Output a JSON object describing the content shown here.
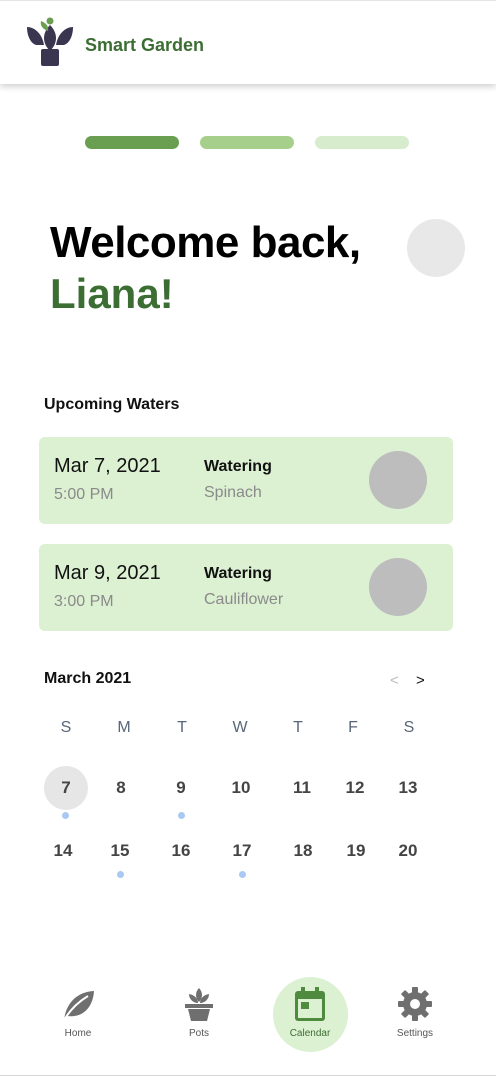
{
  "app": {
    "title": "Smart Garden"
  },
  "colors": {
    "brand_green": "#3c6e34",
    "card_bg": "#dcf0d2",
    "progress": [
      "#6a9e50",
      "#a6cf8c",
      "#d6eccd"
    ],
    "event_dot": "#a9c8f2"
  },
  "welcome": {
    "line1": "Welcome back,",
    "name": "Liana!"
  },
  "upcoming": {
    "title": "Upcoming Waters",
    "cards": [
      {
        "date": "Mar 7, 2021",
        "time": "5:00 PM",
        "action": "Watering",
        "plant": "Spinach"
      },
      {
        "date": "Mar 9, 2021",
        "time": "3:00 PM",
        "action": "Watering",
        "plant": "Cauliflower"
      }
    ]
  },
  "calendar": {
    "month": "March 2021",
    "prev": "<",
    "next": ">",
    "weekdays": [
      "S",
      "M",
      "T",
      "W",
      "T",
      "F",
      "S"
    ],
    "week1": [
      "7",
      "8",
      "9",
      "10",
      "11",
      "12",
      "13"
    ],
    "week2": [
      "14",
      "15",
      "16",
      "17",
      "18",
      "19",
      "20"
    ],
    "selected_day": "7",
    "days_with_events": [
      "7",
      "9",
      "15",
      "17"
    ]
  },
  "nav": {
    "items": [
      {
        "label": "Home",
        "icon": "leaf-icon"
      },
      {
        "label": "Pots",
        "icon": "potted-plant-icon"
      },
      {
        "label": "Calendar",
        "icon": "calendar-icon"
      },
      {
        "label": "Settings",
        "icon": "gear-icon"
      }
    ],
    "active": "Calendar"
  }
}
